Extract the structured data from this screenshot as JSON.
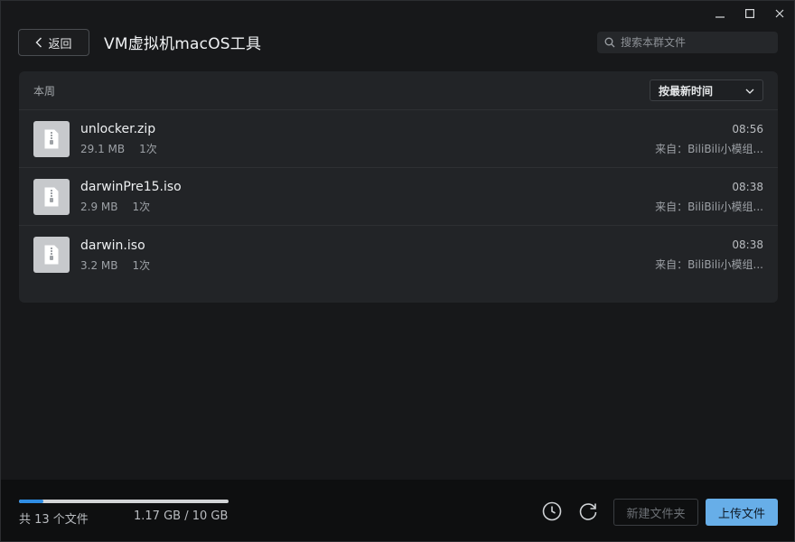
{
  "window": {
    "controls": [
      "minimize-icon",
      "maximize-icon",
      "close-icon"
    ]
  },
  "header": {
    "back_label": "返回",
    "title": "VM虚拟机macOS工具",
    "search_placeholder": "搜索本群文件"
  },
  "panel": {
    "section_label": "本周",
    "sort_label": "按最新时间"
  },
  "files": [
    {
      "name": "unlocker.zip",
      "size": "29.1 MB",
      "count": "1次",
      "time": "08:56",
      "from": "来自：BiliBili小模组..."
    },
    {
      "name": "darwinPre15.iso",
      "size": "2.9 MB",
      "count": "1次",
      "time": "08:38",
      "from": "来自：BiliBili小模组..."
    },
    {
      "name": "darwin.iso",
      "size": "3.2 MB",
      "count": "1次",
      "time": "08:38",
      "from": "来自：BiliBili小模组..."
    }
  ],
  "footer": {
    "file_count": "共 13 个文件",
    "usage": "1.17 GB / 10 GB",
    "usage_fraction": 0.117,
    "new_folder_label": "新建文件夹",
    "upload_label": "上传文件"
  },
  "colors": {
    "accent": "#67aee8",
    "progress": "#2f8de4",
    "background": "#17181a",
    "panel": "#222427"
  }
}
